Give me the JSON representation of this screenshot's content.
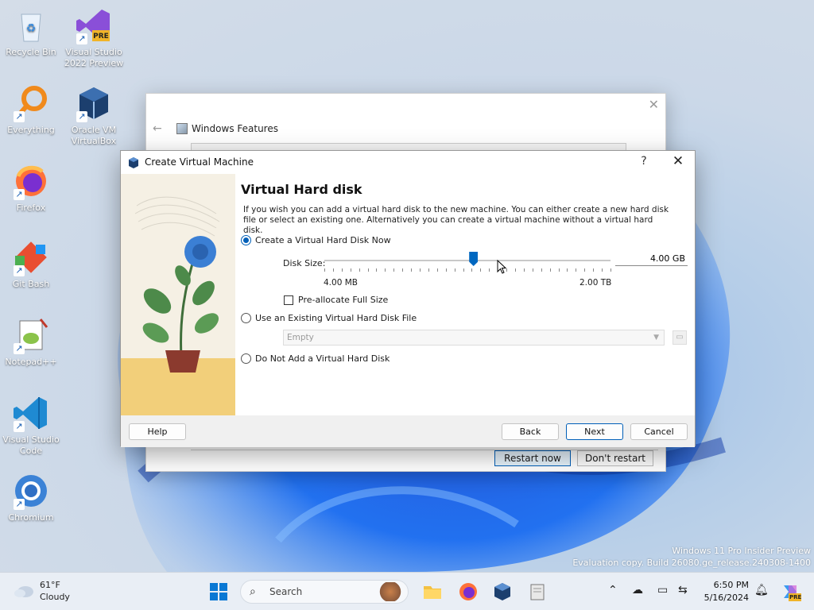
{
  "desktop": {
    "icons": [
      {
        "label": "Recycle Bin"
      },
      {
        "label": "Visual Studio 2022 Preview",
        "badge": "PRE"
      },
      {
        "label": "Everything"
      },
      {
        "label": "Oracle VM VirtualBox"
      },
      {
        "label": "Firefox"
      },
      {
        "label": "Git Bash"
      },
      {
        "label": "Notepad++"
      },
      {
        "label": "Visual Studio Code"
      },
      {
        "label": "Chromium"
      }
    ]
  },
  "bg_window": {
    "title": "Windows Features",
    "restart_label": "Restart now",
    "dont_restart_label": "Don't restart"
  },
  "dialog": {
    "title": "Create Virtual Machine",
    "help_glyph": "?",
    "close_glyph": "✕",
    "heading": "Virtual Hard disk",
    "description": "If you wish you can add a virtual hard disk to the new machine. You can either create a new hard disk file or select an existing one. Alternatively you can create a virtual machine without a virtual hard disk.",
    "options": {
      "create_now": "Create a Virtual Hard Disk Now",
      "use_existing": "Use an Existing Virtual Hard Disk File",
      "do_not_add": "Do Not Add a Virtual Hard Disk"
    },
    "selected_option": "create_now",
    "disk_size_label": "Disk Size:",
    "disk_size_value": "4.00 GB",
    "slider_min_label": "4.00 MB",
    "slider_max_label": "2.00 TB",
    "slider_position_fraction": 0.52,
    "preallocate_label": "Pre-allocate Full Size",
    "preallocate_checked": false,
    "existing_file_value": "Empty",
    "buttons": {
      "help": "Help",
      "back": "Back",
      "next": "Next",
      "cancel": "Cancel"
    }
  },
  "watermark": {
    "line1": "Windows 11 Pro Insider Preview",
    "line2": "Evaluation copy. Build 26080.ge_release.240308-1400"
  },
  "taskbar": {
    "weather_temp": "61°F",
    "weather_cond": "Cloudy",
    "search_placeholder": "Search",
    "time": "6:50 PM",
    "date": "5/16/2024",
    "copilot_badge": "PRE"
  },
  "colors": {
    "accent": "#005fb8",
    "taskbar_bg": "#e9eef5"
  }
}
